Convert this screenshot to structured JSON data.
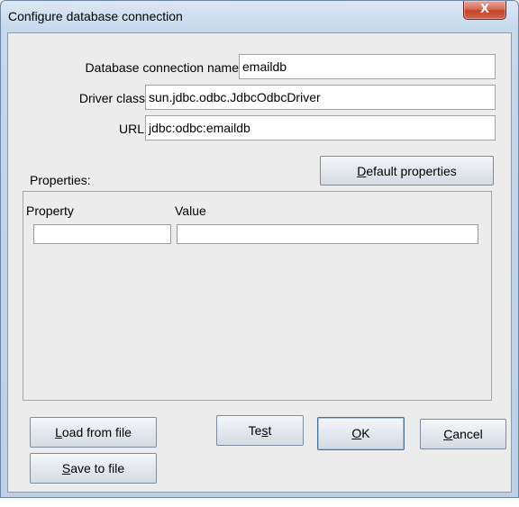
{
  "window": {
    "title": "Configure database connection",
    "close_glyph": "X"
  },
  "form": {
    "name_label": "Database connection name",
    "name_value": "emaildb",
    "driver_label": "Driver class",
    "driver_value": "sun.jdbc.odbc.JdbcOdbcDriver",
    "url_label": "URL",
    "url_value": "jdbc:odbc:emaildb"
  },
  "properties": {
    "section_label": "Properties:",
    "default_button": {
      "mnemonic": "D",
      "rest": "efault properties"
    },
    "columns": [
      "Property",
      "Value"
    ],
    "rows": [
      {
        "property": "",
        "value": ""
      }
    ]
  },
  "buttons": {
    "load": {
      "mnemonic": "L",
      "rest": "oad from file"
    },
    "save": {
      "mnemonic": "S",
      "rest": "ave to file"
    },
    "test": {
      "pre": "Te",
      "mnemonic": "s",
      "post": "t"
    },
    "ok": {
      "mnemonic": "O",
      "rest": "K"
    },
    "cancel": {
      "mnemonic": "C",
      "rest": "ancel"
    }
  }
}
